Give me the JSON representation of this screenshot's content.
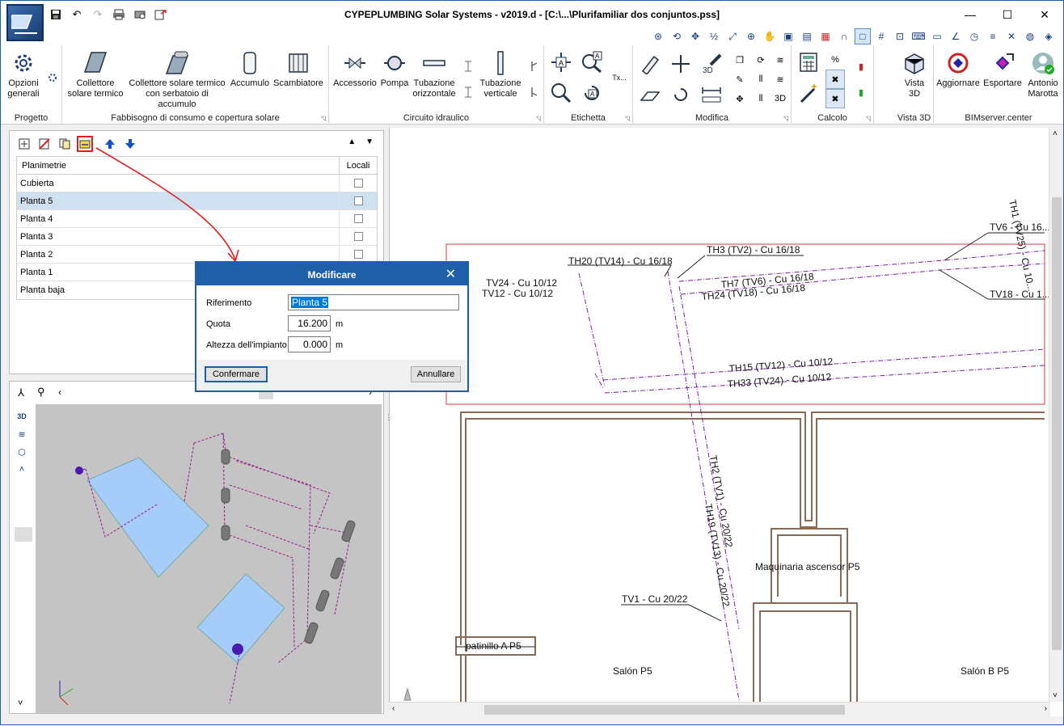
{
  "window": {
    "title": "CYPEPLUMBING Solar Systems - v2019.d - [C:\\...\\Plurifamiliar dos conjuntos.pss]"
  },
  "ribbon": {
    "groups": {
      "progetto": "Progetto",
      "fabbisogno": "Fabbisogno di consumo e copertura solare",
      "circuito": "Circuito idraulico",
      "etichetta": "Etichetta",
      "modifica": "Modifica",
      "calcolo": "Calcolo",
      "vista3d": "Vista 3D",
      "bimserver": "BIMserver.center"
    },
    "buttons": {
      "opzioni": "Opzioni generali",
      "collettore": "Collettore solare termico",
      "collettore_serbatoio": "Collettore solare termico con serbatoio di accumulo",
      "accumulo": "Accumulo",
      "scambiatore": "Scambiatore",
      "accessorio": "Accessorio",
      "pompa": "Pompa",
      "tub_orizzontale": "Tubazione orizzontale",
      "tub_verticale": "Tubazione verticale",
      "vista3d": "Vista 3D",
      "aggiornare": "Aggiornare",
      "esportare": "Esportare",
      "user": "Antonio Marotta"
    },
    "small_labels": {
      "tx": "Tx..."
    }
  },
  "planimetrie": {
    "col_name": "Planimetrie",
    "col_locali": "Locali",
    "rows": [
      {
        "name": "Cubierta",
        "selected": false
      },
      {
        "name": "Planta 5",
        "selected": true
      },
      {
        "name": "Planta 4",
        "selected": false
      },
      {
        "name": "Planta 3",
        "selected": false
      },
      {
        "name": "Planta 2",
        "selected": false
      },
      {
        "name": "Planta 1",
        "selected": false
      },
      {
        "name": "Planta baja",
        "selected": false
      }
    ]
  },
  "dialog": {
    "title": "Modificare",
    "riferimento_label": "Riferimento",
    "riferimento_value": "Planta 5",
    "quota_label": "Quota",
    "quota_value": "16.200",
    "quota_unit": "m",
    "altezza_label": "Altezza dell'impianto",
    "altezza_value": "0.000",
    "altezza_unit": "m",
    "confirm": "Confermare",
    "cancel": "Annullare"
  },
  "drawing": {
    "labels": {
      "tv24": "TV24 - Cu 10/12",
      "tv12": "TV12 - Cu 10/12",
      "th20": "TH20 (TV14) - Cu 16/18",
      "th3": "TH3 (TV2) - Cu 16/18",
      "th7": "TH7 (TV6) - Cu 16/18",
      "th24": "TH24 (TV18) - Cu 16/18",
      "tv6": "TV6 - Cu 16...",
      "tv18": "TV18 - Cu 1...",
      "th15": "TH15 (TV12) - Cu 10/12",
      "th33": "TH33 (TV24) - Cu 10/12",
      "th2": "TH2 (TV1) - Cu 20/22",
      "th19": "TH19 (TV13) - Cu 20/22",
      "tv1": "TV1 - Cu 20/22",
      "maquinaria": "Maquinaria ascensor P5",
      "patinillo": "patinillo A P5",
      "salon": "Salón P5",
      "salon_b": "Salón B P5",
      "th_top": "TH1 (TV25) - Cu 10..."
    }
  },
  "colors": {
    "accent": "#1f5fa8",
    "pipe": "#7a1fa0",
    "wall": "#8b6a55",
    "zone": "#e05a5a",
    "highlight": "#e21d1d"
  }
}
